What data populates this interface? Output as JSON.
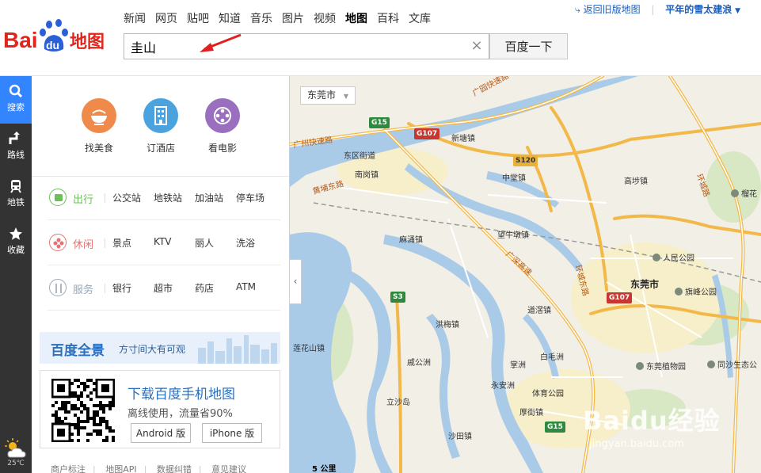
{
  "header": {
    "logo_text": "Baidu地图",
    "nav": [
      "新闻",
      "网页",
      "贴吧",
      "知道",
      "音乐",
      "图片",
      "视频",
      "地图",
      "百科",
      "文库"
    ],
    "nav_active": "地图",
    "search_value": "圭山",
    "clear_icon": "×",
    "search_button": "百度一下",
    "old_version_link": "返回旧版地图",
    "username": "平年的雪太建浪"
  },
  "sidebar": {
    "items": [
      {
        "label": "搜索",
        "icon": "search-icon"
      },
      {
        "label": "路线",
        "icon": "route-icon"
      },
      {
        "label": "地铁",
        "icon": "subway-icon"
      },
      {
        "label": "收藏",
        "icon": "star-icon"
      }
    ],
    "weather": "25℃"
  },
  "panel": {
    "quick": [
      {
        "label": "找美食",
        "color": "#f08a4b"
      },
      {
        "label": "订酒店",
        "color": "#4aa3df"
      },
      {
        "label": "看电影",
        "color": "#9b6fc0"
      }
    ],
    "categories": [
      {
        "name": "出行",
        "color": "#6cbf5a",
        "links": [
          "公交站",
          "地铁站",
          "加油站",
          "停车场"
        ]
      },
      {
        "name": "休闲",
        "color": "#e57272",
        "links": [
          "景点",
          "KTV",
          "丽人",
          "洗浴"
        ]
      },
      {
        "name": "服务",
        "color": "#9ba7b4",
        "links": [
          "银行",
          "超市",
          "药店",
          "ATM"
        ]
      }
    ],
    "pano": {
      "title": "百度全景",
      "subtitle": "方寸间大有可观"
    },
    "app": {
      "title": "下载百度手机地图",
      "desc": "离线使用，流量省90%",
      "android": "Android 版",
      "iphone": "iPhone 版"
    },
    "footer": [
      "商户标注",
      "地图API",
      "数据纠错",
      "意见建议"
    ],
    "collapse_icon": "‹"
  },
  "map": {
    "city_select": "东莞市",
    "scale": "5 公里",
    "watermark": "Baidu经验",
    "watermark_url": "jingyan.baidu.com",
    "labels": {
      "dongguan": "东莞市",
      "xintang": "新塘镇",
      "dongqu": "东区街道",
      "nangang": "南岗镇",
      "zhongtang": "中堂镇",
      "gaobu": "高埗镇",
      "machong": "麻涌镇",
      "wangniudun": "望牛墩镇",
      "daojiao": "道滘镇",
      "hongmei": "洪梅镇",
      "lianhuashan": "莲花山镇",
      "qisha": "戚公洲",
      "baimazhou": "白毛洲",
      "zhangzhou": "掌洲",
      "yongan": "永安洲",
      "tiyu": "体育公园",
      "houjie": "厚街镇",
      "litianzhou": "立沙岛",
      "shatian": "沙田镇",
      "renmin": "人民公园",
      "qifeng": "旗峰公园",
      "zhiwuyuan": "东莞植物园",
      "tongsha": "同沙生态公",
      "liuyuan": "榴花",
      "guangyuan": "广园快速路",
      "guangzhou_hw": "广州快速路",
      "huangpu": "黄埔东路",
      "guangshen": "广深高速",
      "huancheng": "环城东路",
      "huancheng2": "环城路"
    },
    "shields": [
      "G15",
      "G107",
      "S120",
      "S3",
      "G107",
      "G15"
    ]
  },
  "colors": {
    "accent": "#3385ff",
    "water": "#a9cbe8",
    "road": "#f2b94a",
    "green": "#cfe3b5"
  }
}
